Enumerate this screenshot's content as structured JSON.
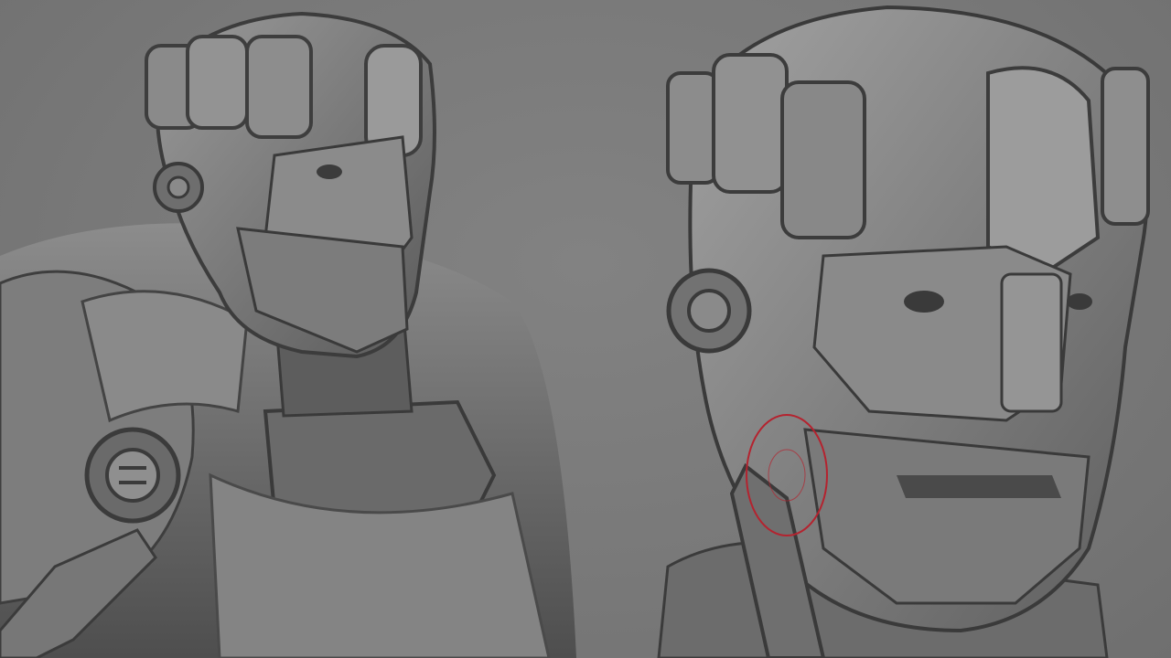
{
  "viewport": {
    "background_color": "#7b7b7b",
    "model_base_color": "#6e6e6e",
    "highlight_color": "#a9a9a9",
    "shadow_color": "#3e3e3e",
    "brush_cursor_color": "#b4232f"
  },
  "views": [
    {
      "name": "left-view",
      "subject": "armored-robot-bust"
    },
    {
      "name": "right-view",
      "subject": "armored-robot-head-closeup"
    }
  ],
  "brush_cursor": {
    "icon": "brush-cursor-ring"
  }
}
